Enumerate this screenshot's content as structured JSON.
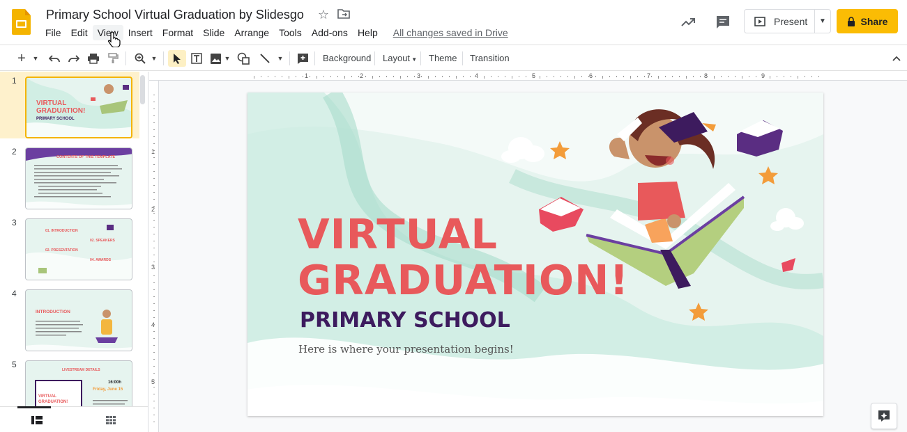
{
  "header": {
    "title": "Primary School Virtual Graduation by Slidesgo",
    "save_status": "All changes saved in Drive",
    "present_label": "Present",
    "share_label": "Share"
  },
  "menu": [
    "File",
    "Edit",
    "View",
    "Insert",
    "Format",
    "Slide",
    "Arrange",
    "Tools",
    "Add-ons",
    "Help"
  ],
  "toolbar": {
    "background_label": "Background",
    "layout_label": "Layout",
    "theme_label": "Theme",
    "transition_label": "Transition"
  },
  "ruler": {
    "h_numbers": [
      "1",
      "2",
      "3",
      "4",
      "5",
      "6",
      "7",
      "8",
      "9"
    ],
    "v_numbers": [
      "1",
      "2",
      "3",
      "4",
      "5"
    ]
  },
  "filmstrip": {
    "slides": [
      {
        "num": "1",
        "title": "VIRTUAL GRADUATION!",
        "sub": "PRIMARY SCHOOL"
      },
      {
        "num": "2",
        "title": "CONTENTS OF THIS TEMPLATE"
      },
      {
        "num": "3",
        "items": [
          "01. INTRODUCTION",
          "02. SPEAKERS",
          "02. PRESENTATION",
          "04. AWARDS"
        ]
      },
      {
        "num": "4",
        "title": "INTRODUCTION"
      },
      {
        "num": "5",
        "title": "LIVESTREAM DETAILS",
        "time": "16:00h",
        "date": "Friday, June 15"
      }
    ]
  },
  "slide": {
    "title_line1": "VIRTUAL",
    "title_line2": "GRADUATION!",
    "subtitle": "PRIMARY SCHOOL",
    "tagline": "Here is where your presentation begins!"
  },
  "colors": {
    "brand": "#f4b400",
    "share": "#fbbc04",
    "slide_bg": "#e6f4ef",
    "title_red": "#e8595b",
    "subtitle_purple": "#3d1b5e",
    "wave": "#b3e0d3"
  }
}
